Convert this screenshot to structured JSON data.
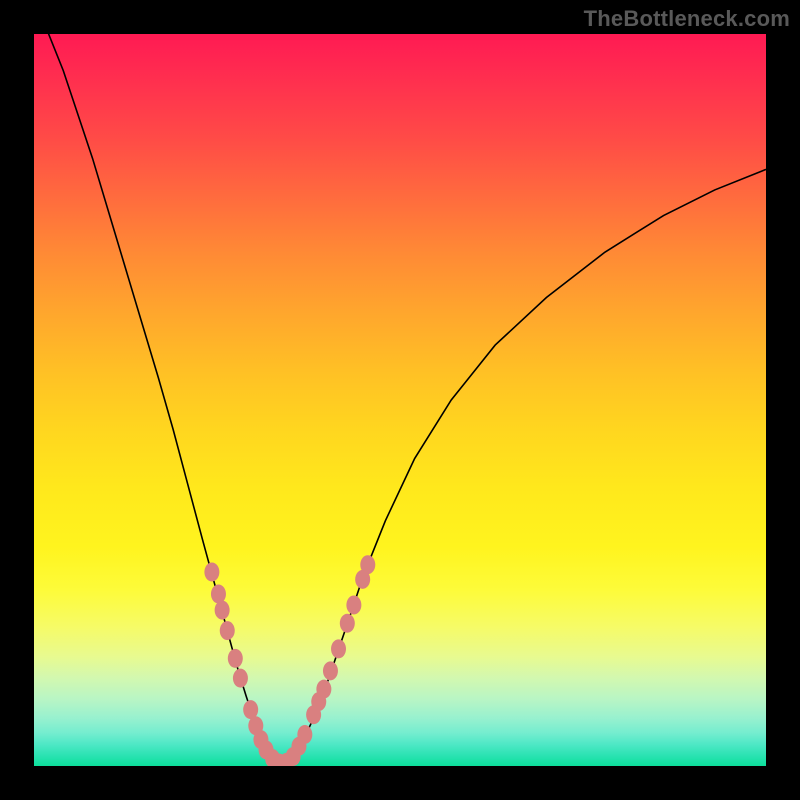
{
  "watermark": "TheBottleneck.com",
  "colors": {
    "frame": "#000000",
    "curve": "#000000",
    "marker": "#d98080"
  },
  "chart_data": {
    "type": "line",
    "title": "",
    "xlabel": "",
    "ylabel": "",
    "xlim": [
      0,
      100
    ],
    "ylim": [
      0,
      100
    ],
    "grid": false,
    "legend": false,
    "series": [
      {
        "name": "left-branch",
        "x": [
          0,
          4,
          8,
          11,
          14,
          17,
          19,
          21,
          23,
          24.5,
          26,
          27,
          28,
          29,
          30,
          30.8,
          31.6,
          32.8,
          34
        ],
        "y": [
          105,
          95,
          83,
          73,
          63,
          53,
          46,
          38.5,
          31,
          25.5,
          20,
          16.3,
          12.7,
          9.5,
          6.5,
          4.3,
          2.3,
          0.8,
          0
        ]
      },
      {
        "name": "right-branch",
        "x": [
          34,
          35.5,
          37,
          38.5,
          40,
          41.5,
          43,
          45,
          48,
          52,
          57,
          63,
          70,
          78,
          86,
          93,
          100
        ],
        "y": [
          0,
          1.5,
          4,
          7.2,
          11.2,
          15.6,
          20,
          26,
          33.5,
          42,
          50,
          57.5,
          64,
          70.2,
          75.2,
          78.7,
          81.5
        ]
      }
    ],
    "markers": {
      "name": "highlighted-points",
      "points": [
        {
          "x": 24.3,
          "y": 26.5
        },
        {
          "x": 25.2,
          "y": 23.5
        },
        {
          "x": 25.7,
          "y": 21.3
        },
        {
          "x": 26.4,
          "y": 18.5
        },
        {
          "x": 27.5,
          "y": 14.7
        },
        {
          "x": 28.2,
          "y": 12.0
        },
        {
          "x": 29.6,
          "y": 7.7
        },
        {
          "x": 30.3,
          "y": 5.5
        },
        {
          "x": 31.0,
          "y": 3.6
        },
        {
          "x": 31.7,
          "y": 2.2
        },
        {
          "x": 32.6,
          "y": 1.0
        },
        {
          "x": 33.5,
          "y": 0.4
        },
        {
          "x": 34.5,
          "y": 0.5
        },
        {
          "x": 35.4,
          "y": 1.3
        },
        {
          "x": 36.2,
          "y": 2.7
        },
        {
          "x": 37.0,
          "y": 4.3
        },
        {
          "x": 38.2,
          "y": 7.0
        },
        {
          "x": 38.9,
          "y": 8.8
        },
        {
          "x": 39.6,
          "y": 10.5
        },
        {
          "x": 40.5,
          "y": 13.0
        },
        {
          "x": 41.6,
          "y": 16.0
        },
        {
          "x": 42.8,
          "y": 19.5
        },
        {
          "x": 43.7,
          "y": 22.0
        },
        {
          "x": 44.9,
          "y": 25.5
        },
        {
          "x": 45.6,
          "y": 27.5
        }
      ]
    }
  }
}
